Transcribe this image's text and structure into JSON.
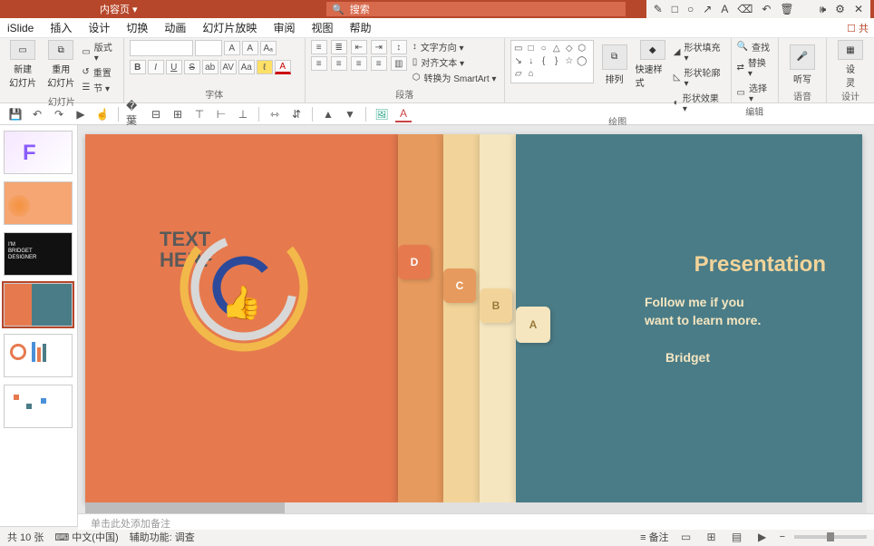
{
  "titlebar": {
    "doc": "内容页 ▾",
    "search_placeholder": "搜索"
  },
  "tabs": {
    "items": [
      "iSlide",
      "插入",
      "设计",
      "切换",
      "动画",
      "幻灯片放映",
      "审阅",
      "视图",
      "帮助"
    ],
    "share": "☐ 共"
  },
  "ribbon": {
    "slides": {
      "new": "新建\n幻灯片",
      "reuse": "重用\n幻灯片",
      "layout": "版式 ▾",
      "reset": "重置",
      "section": "节 ▾",
      "label": "幻灯片"
    },
    "font": {
      "sizeA1": "A",
      "sizeA2": "A",
      "clear": "Aₐ",
      "b": "B",
      "i": "I",
      "u": "U",
      "s": "S",
      "ab": "ab",
      "av": "AV",
      "aa": "Aa",
      "color": "A",
      "label": "字体"
    },
    "para": {
      "textdir": "文字方向 ▾",
      "align": "对齐文本 ▾",
      "smart": "转换为 SmartArt ▾",
      "label": "段落"
    },
    "draw": {
      "arrange": "排列",
      "quick": "快速样式",
      "fill": "形状填充 ▾",
      "outline": "形状轮廓 ▾",
      "effect": "形状效果 ▾",
      "label": "绘图"
    },
    "edit": {
      "find": "查找",
      "replace": "替换 ▾",
      "select": "选择 ▾",
      "label": "编辑"
    },
    "voice": {
      "dictate": "听写",
      "label": "语音"
    },
    "designer": {
      "ideas": "设\n灵",
      "label": "设计"
    }
  },
  "slide": {
    "text_here_1": "TEXT",
    "text_here_2": "HERE",
    "tab_a": "A",
    "tab_b": "B",
    "tab_c": "C",
    "tab_d": "D",
    "title": "Presentation",
    "sub1": "Follow me if you",
    "sub2": "want to learn  more.",
    "author": "Bridget"
  },
  "thumbnails": {
    "t3_1": "I'M",
    "t3_2": "BRIDGET",
    "t3_3": "DESIGNER"
  },
  "notes": {
    "placeholder": "单击此处添加备注"
  },
  "status": {
    "slide_count": "共 10 张",
    "lang": "中文(中国)",
    "access": "辅助功能: 调查",
    "notes_btn": "备注"
  }
}
